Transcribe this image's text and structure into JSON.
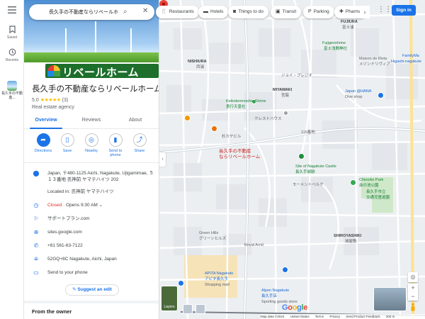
{
  "rail": {
    "saved_label": "Saved",
    "recents_label": "Recents",
    "recent_place_label": "長久手の不動産..."
  },
  "search": {
    "value": "長久手の不動産ならリベールホ"
  },
  "chips": [
    {
      "label": "Restaurants",
      "icon": "fork-knife-icon"
    },
    {
      "label": "Hotels",
      "icon": "bed-icon"
    },
    {
      "label": "Things to do",
      "icon": "camera-icon"
    },
    {
      "label": "Transit",
      "icon": "train-icon"
    },
    {
      "label": "Parking",
      "icon": "parking-icon"
    },
    {
      "label": "Pharma",
      "icon": "pharmacy-icon"
    }
  ],
  "header": {
    "signin_label": "Sign in"
  },
  "place": {
    "logo_text": "リベールホーム",
    "title": "長久手の不動産ならリベールホーム",
    "rating": "5.0",
    "stars": "★★★★★",
    "review_count": "(3)",
    "category": "Real estate agency",
    "tabs": [
      "Overview",
      "Reviews",
      "About"
    ],
    "actions": [
      {
        "label": "Directions",
        "icon": "directions-icon"
      },
      {
        "label": "Save",
        "icon": "bookmark-icon"
      },
      {
        "label": "Nearby",
        "icon": "nearby-icon"
      },
      {
        "label": "Send to phone",
        "icon": "send-to-phone-icon"
      },
      {
        "label": "Share",
        "icon": "share-icon"
      }
    ],
    "address": "Japan, 〒480-1125 Aichi, Nagakute, Ujigamimae, ５１３番地 氏神前 ヤマテハイツ 202",
    "located_in": "Located in: 氏神前 ヤマテハイツ",
    "hours_status": "Closed",
    "hours_detail": " · Opens 9:30 AM",
    "service": "サポートプラン.com",
    "website": "sites.google.com",
    "phone": "+81 561-63-7122",
    "plus_code": "52GQ+8C Nagakute, Aichi, Japan",
    "send_to_phone": "Send to your phone",
    "suggest_edit": "Suggest an edit",
    "from_owner": "From the owner"
  },
  "map": {
    "pin_label_line1": "長久手の不動産",
    "pin_label_line2": "ならリベールホーム",
    "layers_label": "Layers",
    "google_logo": "Google",
    "footer": [
      "Map data ©2024",
      "United States",
      "Terms",
      "Privacy",
      "Send Product Feedback",
      "200 m"
    ],
    "labels": {
      "fujigaoka": "FUJIGAOKA",
      "fujigaoka_jp": "藤が丘",
      "fujiura": "FUJIURA",
      "fujiura_jp": "富士浦",
      "nishiura": "NISHIURA",
      "nishiura_jp": "西浦",
      "miyawaki": "MIYAWAKI",
      "miyawaki_jp": "宮脇",
      "shiroyashiki": "SHIROYASHIKI",
      "shiroyashiki_jp": "城屋敷",
      "fujigenshrine": "Fujigenshrine",
      "fujigenshrine_jp": "富士浅間神社",
      "keikoten": "Keikotenmoshia Shrine",
      "keikoten_jp": "景行天皇社",
      "castle": "Site of Nagakute Castle",
      "castle_jp": "長久手城跡",
      "chinoike": "Chinoike Park",
      "chinoike_jp": "血の池公園",
      "apita": "APITA Nagakute",
      "apita_jp": "アピタ長久手",
      "apita_sub": "Shopping mall",
      "alpen": "Alpen Nagakute",
      "alpen_jp": "長久手店",
      "alpen_sub": "Sporting goods store",
      "hana": "Japan @HANA",
      "hana_sub": "Dive shop",
      "familymart": "FamilyMa",
      "familymart_sub": "Higashi-nagakute",
      "maison": "Maison de Rivia",
      "maison_jp": "メゾンドリヴィア",
      "sugikaya": "杉カヤビル",
      "royal": "Royal Arrid",
      "green_hills": "Green Hills",
      "green_hills_jp": "グリーンヒルズ",
      "kohama": "長久手市立",
      "kohama2": "交通児童遊園",
      "mountain": "モーメントベルク",
      "town115": "115番地",
      "cresthouse": "クレストハウス",
      "jsoleil": "ジョイ・プレジオ"
    }
  }
}
